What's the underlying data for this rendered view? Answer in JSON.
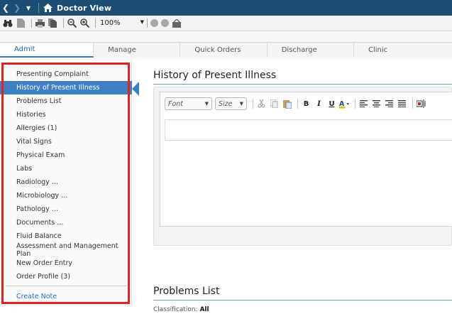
{
  "window": {
    "title": "Doctor View"
  },
  "toolbar": {
    "zoom": "100%"
  },
  "tabs": [
    {
      "label": "Admit"
    },
    {
      "label": "Manage"
    },
    {
      "label": "Quick Orders"
    },
    {
      "label": "Discharge"
    },
    {
      "label": "Clinic"
    }
  ],
  "sidebar": {
    "items": [
      {
        "label": "Presenting Complaint"
      },
      {
        "label": "History of Present Illness"
      },
      {
        "label": "Problems List"
      },
      {
        "label": "Histories"
      },
      {
        "label": "Allergies (1)"
      },
      {
        "label": "Vital Signs"
      },
      {
        "label": "Physical Exam"
      },
      {
        "label": "Labs"
      },
      {
        "label": "Radiology ..."
      },
      {
        "label": "Microbiology ..."
      },
      {
        "label": "Pathology ..."
      },
      {
        "label": "Documents ..."
      },
      {
        "label": "Fluid Balance"
      },
      {
        "label": "Assessment and Management Plan"
      },
      {
        "label": "New Order Entry"
      },
      {
        "label": "Order Profile (3)"
      },
      {
        "label": "Create Note"
      }
    ]
  },
  "main": {
    "hpi_title": "History of Present Illness",
    "editor": {
      "font_placeholder": "Font",
      "size_placeholder": "Size"
    },
    "problems_title": "Problems List",
    "classification_label": "Classification:",
    "classification_value": "All"
  },
  "colors": {
    "titlebar": "#1c4e74",
    "selected": "#3f7fc4",
    "highlight_box": "#e32222",
    "link": "#2a6db3"
  }
}
